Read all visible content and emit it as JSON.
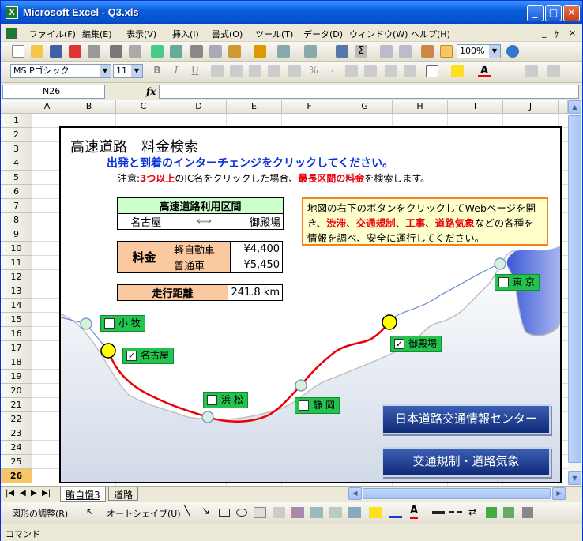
{
  "window": {
    "title": "Microsoft Excel - Q3.xls",
    "app_icon_label": "X"
  },
  "menu": [
    "ファイル(F)",
    "編集(E)",
    "表示(V)",
    "挿入(I)",
    "書式(O)",
    "ツール(T)",
    "データ(D)",
    "ウィンドウ(W)",
    "ヘルプ(H)"
  ],
  "toolbar": {
    "zoom": "100%",
    "font_name": "MS Pゴシック",
    "font_size": "11"
  },
  "formula_bar": {
    "name_box": "N26",
    "fx": "fx",
    "content": ""
  },
  "columns": [
    "A",
    "B",
    "C",
    "D",
    "E",
    "F",
    "G",
    "H",
    "I",
    "J"
  ],
  "rows": [
    "1",
    "2",
    "3",
    "4",
    "5",
    "6",
    "7",
    "8",
    "9",
    "10",
    "11",
    "12",
    "13",
    "14",
    "15",
    "16",
    "17",
    "18",
    "19",
    "20",
    "21",
    "22",
    "23",
    "24",
    "25",
    "26"
  ],
  "active_row": "26",
  "sheet": {
    "title": "高速道路　料金検索",
    "instruction": "出発と到着のインターチェンジをクリックしてください。",
    "note_prefix": "注意:",
    "note_highlight1": "3つ以上",
    "note_middle": "のIC名をクリックした場合、",
    "note_highlight2": "最長区間の料金",
    "note_suffix": "を検索します。",
    "section": {
      "header": "高速道路利用区間",
      "from": "名古屋",
      "to": "御殿場",
      "arrow": "⟺"
    },
    "fee": {
      "label": "料金",
      "rows": [
        {
          "type": "軽自動車",
          "price": "¥4,400"
        },
        {
          "type": "普通車",
          "price": "¥5,450"
        }
      ]
    },
    "distance": {
      "label": "走行距離",
      "value": "241.8 km"
    },
    "info_text_parts": [
      "地図の右下のボタンをクリックしてWebページを開き、",
      "渋滞",
      "、",
      "交通規制",
      "、",
      "工事",
      "、",
      "道路気象",
      "などの各種を情報を調べ、安全に運行してください。"
    ],
    "ic_tags": [
      {
        "name": "小 牧",
        "checked": false
      },
      {
        "name": "名古屋",
        "checked": true
      },
      {
        "name": "浜 松",
        "checked": false
      },
      {
        "name": "静 岡",
        "checked": false
      },
      {
        "name": "御殿場",
        "checked": true
      },
      {
        "name": "東 京",
        "checked": false
      }
    ],
    "buttons": {
      "jartic": "日本道路交通情報センター",
      "weather": "交通規制・道路気象"
    }
  },
  "tabs": [
    "賄自慢3",
    "道路"
  ],
  "drawbar": {
    "shape_adjust": "図形の調整(R)",
    "autoshape": "オートシェイプ(U)"
  },
  "status": "コマンド",
  "colors": {
    "title_blue": "#0831d9",
    "red_text": "#e8000b",
    "green_header": "#ccffcc",
    "fee_orange": "#fbc9a0",
    "info_bg": "#ffffcc",
    "tag_green": "#24c24f",
    "road_red": "#e8000b"
  }
}
